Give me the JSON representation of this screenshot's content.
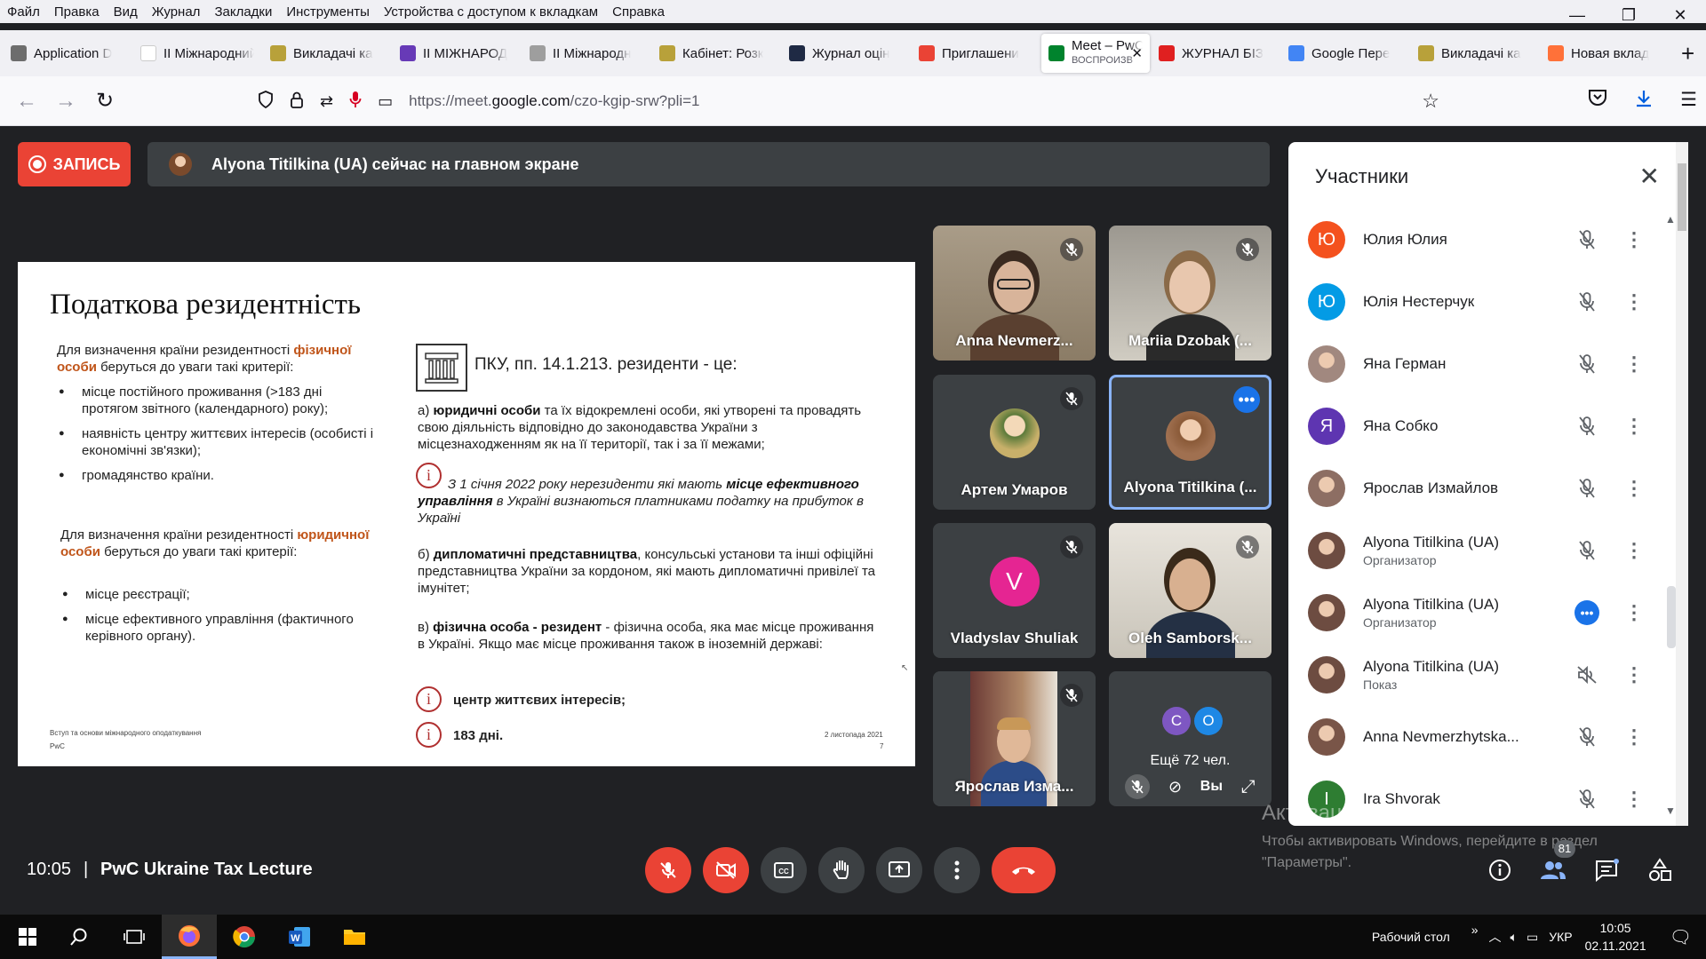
{
  "menu": [
    "Файл",
    "Правка",
    "Вид",
    "Журнал",
    "Закладки",
    "Инструменты",
    "Устройства с доступом к вкладкам",
    "Справка"
  ],
  "tabs": [
    {
      "label": "Application D",
      "color": "#6d6d6d",
      "icon": "gear-icon"
    },
    {
      "label": "II Міжнародний",
      "color": "#ffffff",
      "icon": "blank-icon"
    },
    {
      "label": "Викладачі ка",
      "color": "#b8a13a",
      "icon": "university-seal-icon"
    },
    {
      "label": "II МІЖНАРОД",
      "color": "#673ab7",
      "icon": "forms-icon"
    },
    {
      "label": "II Міжнародн",
      "color": "#9e9e9e",
      "icon": "trident-icon"
    },
    {
      "label": "Кабінет: Розк",
      "color": "#b8a13a",
      "icon": "university-seal-icon"
    },
    {
      "label": "Журнал оцін",
      "color": "#1f2a44",
      "icon": "journal-icon"
    },
    {
      "label": "Приглашени",
      "color": "#ea4335",
      "icon": "gmail-icon"
    },
    {
      "label": "Meet – PwC",
      "sub": "ВОСПРОИЗВ",
      "color": "#00832d",
      "icon": "meet-icon",
      "active": true
    },
    {
      "label": "ЖУРНАЛ БІЗ",
      "color": "#e02020",
      "icon": "bi-logo-icon"
    },
    {
      "label": "Google Пере",
      "color": "#4285f4",
      "icon": "translate-icon"
    },
    {
      "label": "Викладачі ка",
      "color": "#b8a13a",
      "icon": "university-seal-icon"
    },
    {
      "label": "Новая вклад",
      "color": "#ff7139",
      "icon": "firefox-icon"
    }
  ],
  "url": {
    "prefix": "https://meet.",
    "host": "google.com",
    "path": "/czo-kgip-srw?pli=1"
  },
  "recording_label": "ЗАПИСЬ",
  "presenting_banner": "Alyona Titilkina (UA) сейчас на главном экране",
  "slide": {
    "title": "Податкова резидентність",
    "left_p1_a": "Для визначення країни резидентності ",
    "left_p1_hl": "фізичної особи",
    "left_p1_b": " беруться до  уваги такі критерії:",
    "left_list1": [
      "місце постійного проживання (>183 дні протягом звітного (календарного) року);",
      "наявність центру життєвих інтересів (особисті і економічні зв'язки);",
      "громадянство країни."
    ],
    "left_p2_a": "Для визначення країни резидентності ",
    "left_p2_hl": "юридичної особи",
    "left_p2_b": " беруться до уваги такі критерії:",
    "left_list2": [
      "місце реєстрації;",
      "місце ефективного управління (фактичного керівного органу)."
    ],
    "pku_heading": "ПКУ, пп. 14.1.213. резиденти - це:",
    "a_prefix": "а) ",
    "a_bold": "юридичні особи",
    "a_rest": " та їх відокремлені особи, які утворені та провадять свою діяльність відповідно до законодавства України з місцезнаходженням як на її території, так і за її межами;",
    "note_a": "З 1 січня 2022 року нерезиденти які мають ",
    "note_b": "місце ефективного управління",
    "note_c": " в Україні визнаються платниками податку на прибуток в Україні",
    "b_prefix": "б) ",
    "b_bold": "дипломатичні представництва",
    "b_rest": ", консульські установи та інші офіційні представництва України за кордоном, які мають дипломатичні привілеї та імунітет;",
    "c_prefix": "в) ",
    "c_bold": "фізична особа - резидент",
    "c_rest": " - фізична особа, яка має місце проживання в Україні. Якщо має місце проживання також в іноземній державі:",
    "item1": "центр життєвих інтересів;",
    "item2": "183 дні.",
    "info_symbol": "i",
    "footer_left_1": "Вступ та основи міжнародного оподаткування",
    "footer_left_2": "PwC",
    "footer_date": "2 листопада 2021",
    "footer_page": "7"
  },
  "tiles": [
    {
      "name": "Anna Nevmerz...",
      "type": "video",
      "muted": true
    },
    {
      "name": "Mariia Dzobak (...",
      "type": "video",
      "muted": true
    },
    {
      "name": "Артем Умаров",
      "type": "avatar",
      "muted": true
    },
    {
      "name": "Alyona Titilkina (...",
      "type": "avatar",
      "muted": false,
      "selected": true
    },
    {
      "name": "Vladyslav Shuliak",
      "type": "letter",
      "letter": "V",
      "color": "#e52592",
      "muted": true
    },
    {
      "name": "Oleh Samborsk...",
      "type": "video",
      "muted": true
    },
    {
      "name": "Ярослав Изма...",
      "type": "video",
      "muted": true
    },
    {
      "name": "Ещё 72 чел.",
      "type": "more",
      "letters": [
        "С",
        "О"
      ],
      "colors": [
        "#7e57c2",
        "#1e88e5"
      ]
    }
  ],
  "self_label": "Вы",
  "panel": {
    "title": "Участники",
    "participants": [
      {
        "name": "Юлия Юлия",
        "sub": "",
        "initial": "Ю",
        "color": "#f4511e",
        "status": "muted"
      },
      {
        "name": "Юлія Нестерчук",
        "sub": "",
        "initial": "Ю",
        "color": "#039be5",
        "status": "muted"
      },
      {
        "name": "Яна Герман",
        "sub": "",
        "initial": "",
        "color": "#a1887f",
        "status": "muted"
      },
      {
        "name": "Яна Собко",
        "sub": "",
        "initial": "Я",
        "color": "#5e35b1",
        "status": "muted"
      },
      {
        "name": "Ярослав Измайлов",
        "sub": "",
        "initial": "",
        "color": "#8d6e63",
        "status": "muted"
      },
      {
        "name": "Alyona Titilkina (UA)",
        "sub": "Организатор",
        "initial": "",
        "color": "#6d4c41",
        "status": "muted"
      },
      {
        "name": "Alyona Titilkina (UA)",
        "sub": "Организатор",
        "initial": "",
        "color": "#6d4c41",
        "status": "speaking"
      },
      {
        "name": "Alyona Titilkina (UA)",
        "sub": "Показ",
        "initial": "",
        "color": "#6d4c41",
        "status": "audio-off"
      },
      {
        "name": "Anna Nevmerzhytska...",
        "sub": "",
        "initial": "",
        "color": "#795548",
        "status": "muted"
      },
      {
        "name": "Ira Shvorak",
        "sub": "",
        "initial": "I",
        "color": "#2e7d32",
        "status": "muted"
      }
    ]
  },
  "bottom": {
    "time": "10:05",
    "separator": "|",
    "meeting_name": "PwC Ukraine Tax Lecture",
    "participant_count": "81"
  },
  "windows_activation": {
    "title": "Активация Windows",
    "body": "Чтобы активировать Windows, перейдите в раздел \"Параметры\"."
  },
  "taskbar": {
    "desktop_label": "Рабочий стол",
    "chevron": "»",
    "lang": "УКР",
    "clock_time": "10:05",
    "clock_date": "02.11.2021"
  }
}
